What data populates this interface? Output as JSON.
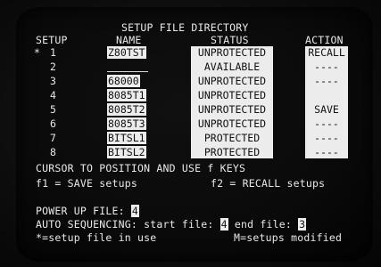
{
  "header": {
    "title": "SETUP FILE DIRECTORY",
    "col_setup": "SETUP",
    "col_name": "NAME",
    "col_status": "STATUS",
    "col_action": "ACTION"
  },
  "rows": [
    {
      "marker": "*",
      "num": "1",
      "name": "Z80TST",
      "status": "UNPROTECTED",
      "action": "RECALL"
    },
    {
      "marker": "",
      "num": "2",
      "name": "",
      "status": "AVAILABLE",
      "action": "----"
    },
    {
      "marker": "",
      "num": "3",
      "name": "68000",
      "status": "UNPROTECTED",
      "action": "----"
    },
    {
      "marker": "",
      "num": "4",
      "name": "8085T1",
      "status": "UNPROTECTED",
      "action": ""
    },
    {
      "marker": "",
      "num": "5",
      "name": "8085T2",
      "status": "UNPROTECTED",
      "action": "SAVE"
    },
    {
      "marker": "",
      "num": "6",
      "name": "8085T3",
      "status": "UNPROTECTED",
      "action": "----"
    },
    {
      "marker": "",
      "num": "7",
      "name": "BITSL1",
      "status": "PROTECTED",
      "action": "----"
    },
    {
      "marker": "",
      "num": "8",
      "name": "BITSL2",
      "status": "PROTECTED",
      "action": "----"
    }
  ],
  "help": {
    "line1": "CURSOR TO POSITION AND USE f KEYS",
    "f1": "f1 = SAVE setups",
    "f2": "f2 = RECALL setups"
  },
  "footer": {
    "power_up_label": "POWER UP FILE:",
    "power_up_value": "4",
    "auto_seq_label": "AUTO SEQUENCING:",
    "start_label": "start file:",
    "start_value": "4",
    "end_label": "end file:",
    "end_value": "3",
    "legend_in_use": "*=setup file in use",
    "legend_modified": "M=setups modified"
  }
}
